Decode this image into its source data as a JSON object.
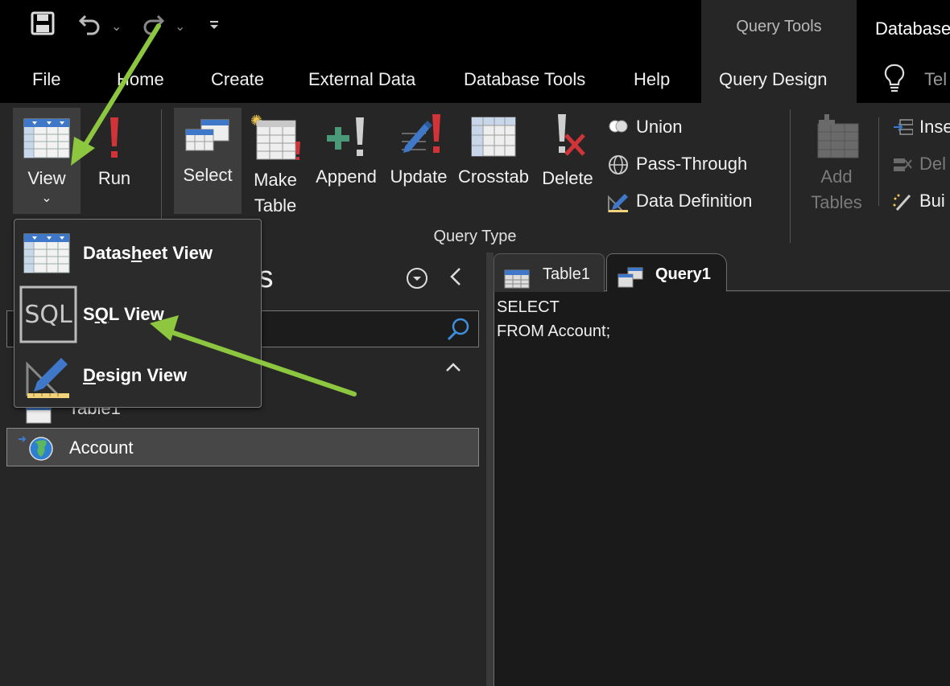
{
  "title_bar": {
    "context_tools": "Query Tools",
    "app_title": "Database"
  },
  "ribbon_tabs": [
    "File",
    "Home",
    "Create",
    "External Data",
    "Database Tools",
    "Help",
    "Query Design"
  ],
  "tell_me": "Tel",
  "ribbon": {
    "view": "View",
    "run": "Run",
    "select": "Select",
    "make_table": "Make Table",
    "append": "Append",
    "update": "Update",
    "crosstab": "Crosstab",
    "delete": "Delete",
    "union": "Union",
    "pass_through": "Pass-Through",
    "data_definition": "Data Definition",
    "add_tables": "Add Tables",
    "insert": "Inse",
    "delete_rows": "Del",
    "builder": "Bui",
    "group_label": "Query Type"
  },
  "nav_pane": {
    "title_fragment": "ts",
    "items": [
      "Table1",
      "Account"
    ]
  },
  "doc_tabs": [
    "Table1",
    "Query1"
  ],
  "sql_text": "SELECT\nFROM Account;",
  "view_menu": {
    "datasheet": {
      "pre": "Datas",
      "u": "h",
      "post": "eet View"
    },
    "sql": {
      "pre": "S",
      "u": "Q",
      "post": "L View"
    },
    "design": {
      "pre": "",
      "u": "D",
      "post": "esign View"
    },
    "sql_icon_text": "SQL"
  },
  "colors": {
    "annotation_arrow": "#8dc63f",
    "run_accent": "#d13438",
    "table_blue": "#3f78c8"
  }
}
